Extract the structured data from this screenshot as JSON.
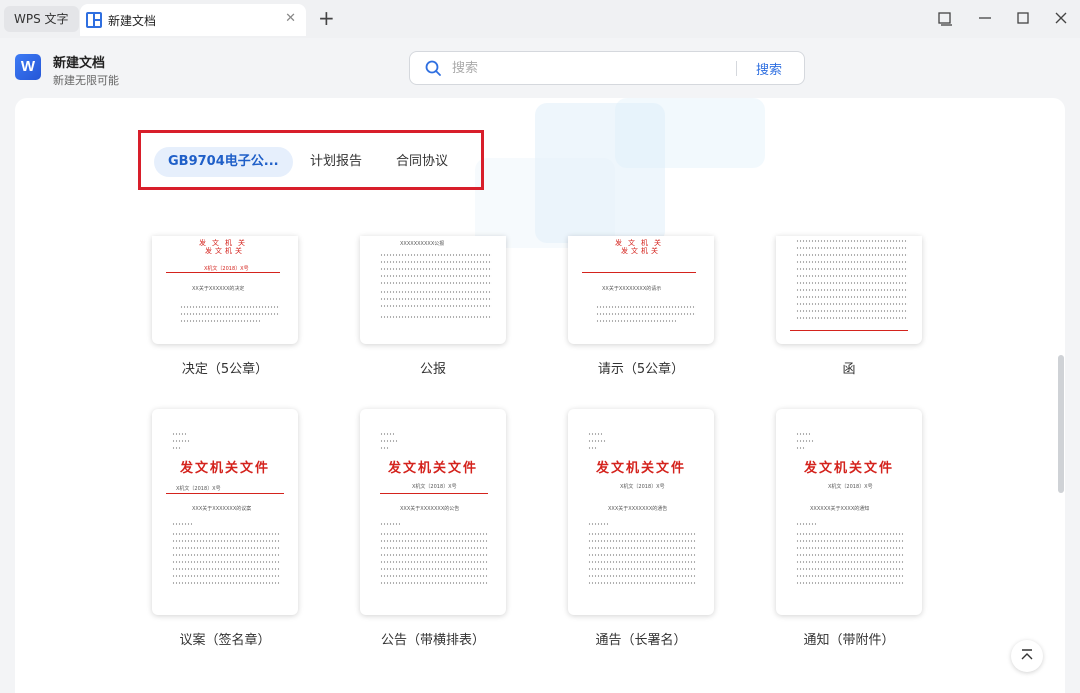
{
  "titlebar": {
    "app_tab": "WPS 文字",
    "doc_tab": "新建文档",
    "close_icon": "close-icon",
    "new_tab_icon": "plus-icon",
    "window_controls": [
      "restore-window-icon",
      "minimize-icon",
      "maximize-icon",
      "close-window-icon"
    ]
  },
  "header": {
    "logo_letter": "W",
    "title": "新建文档",
    "subtitle": "新建无限可能",
    "search": {
      "placeholder": "搜索",
      "button": "搜索"
    }
  },
  "categories": [
    {
      "label": "GB9704电子公...",
      "active": true
    },
    {
      "label": "计划报告",
      "active": false
    },
    {
      "label": "合同协议",
      "active": false
    }
  ],
  "templates": {
    "row1": [
      "决定（5公章）",
      "公报",
      "请示（5公章）",
      "函"
    ],
    "row2": [
      "议案（签名章）",
      "公告（带横排表）",
      "通告（长署名）",
      "通知（带附件）"
    ]
  },
  "thumb_text": {
    "doc_header": "发文机关文件",
    "row1_red": [
      "发文机关",
      "发文机关",
      "发文机关",
      ""
    ],
    "subjects": [
      "XX关于XXXXXX的决定",
      "XXXXXXXXXX公报",
      "XX关于XXXXXXXX的请示",
      "",
      "XXX关于XXXXXXX的议案",
      "XXX关于XXXXXXX的公告",
      "XXX关于XXXXXXX的通告",
      "XXXXXX关于XXXX的通知"
    ],
    "docnum": "X机文〔2018〕X号"
  },
  "colors": {
    "accent": "#2f6fe0",
    "highlight_box": "#d81e2a",
    "doc_red": "#d4231d",
    "active_tab_bg": "#e6effc"
  }
}
